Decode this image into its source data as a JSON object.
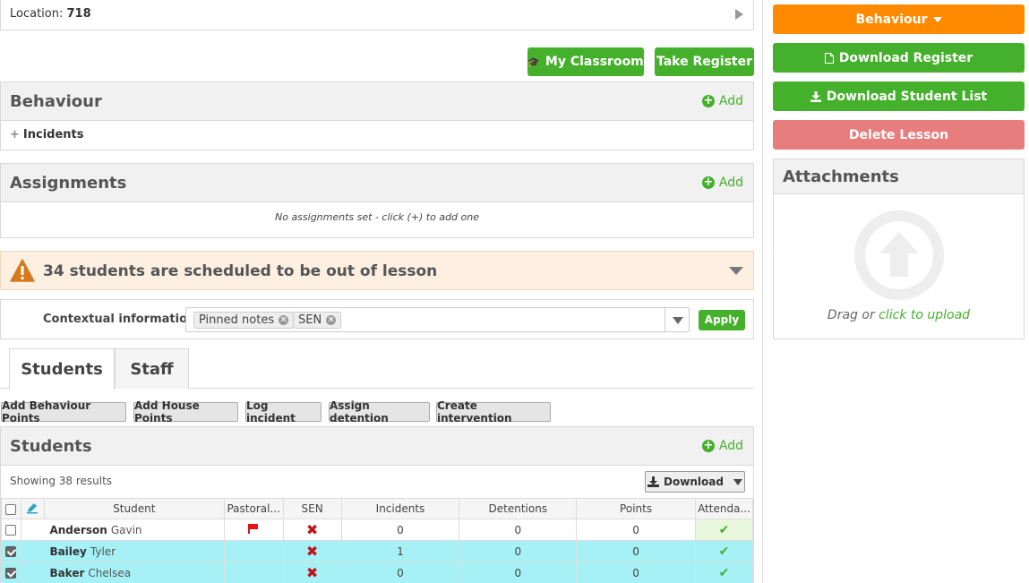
{
  "location": {
    "label": "Location:",
    "value": "718"
  },
  "top_buttons": {
    "my_classroom": "My Classroom",
    "take_register": "Take Register"
  },
  "behaviour_panel": {
    "title": "Behaviour",
    "add": "Add",
    "incidents": "Incidents"
  },
  "assignments_panel": {
    "title": "Assignments",
    "add": "Add",
    "empty": "No assignments set - click (+) to add one"
  },
  "warning": {
    "text": "34 students are scheduled to be out of lesson"
  },
  "contextual": {
    "label": "Contextual information",
    "tags": [
      "Pinned notes",
      "SEN"
    ],
    "apply": "Apply"
  },
  "tabs": [
    "Students",
    "Staff"
  ],
  "actions": [
    "Add Behaviour Points",
    "Add House Points",
    "Log incident",
    "Assign detention",
    "Create intervention"
  ],
  "students_section": {
    "title": "Students",
    "add": "Add",
    "showing": "Showing 38 results",
    "download": "Download",
    "columns": [
      "Student",
      "Pastoral...",
      "SEN",
      "Incidents",
      "Detentions",
      "Points",
      "Attenda..."
    ],
    "rows": [
      {
        "last": "Anderson",
        "first": "Gavin",
        "checked": false,
        "pastoral_flag": true,
        "sen": true,
        "incidents": "0",
        "detentions": "0",
        "points": "0",
        "attendance": true
      },
      {
        "last": "Bailey",
        "first": "Tyler",
        "checked": true,
        "pastoral_flag": false,
        "sen": true,
        "incidents": "1",
        "detentions": "0",
        "points": "0",
        "attendance": true
      },
      {
        "last": "Baker",
        "first": "Chelsea",
        "checked": true,
        "pastoral_flag": false,
        "sen": true,
        "incidents": "0",
        "detentions": "0",
        "points": "0",
        "attendance": true
      }
    ]
  },
  "right": {
    "behaviour": "Behaviour",
    "download_register": "Download Register",
    "download_student_list": "Download Student List",
    "delete_lesson": "Delete Lesson",
    "attachments_title": "Attachments",
    "drag_text": "Drag or",
    "upload_link": "click to upload"
  },
  "colors": {
    "green": "#45b02b",
    "orange": "#ff8a00",
    "red_button": "#e77d7d",
    "selected_row": "#a6f1f6",
    "warning_bg": "#fdf0e3"
  }
}
